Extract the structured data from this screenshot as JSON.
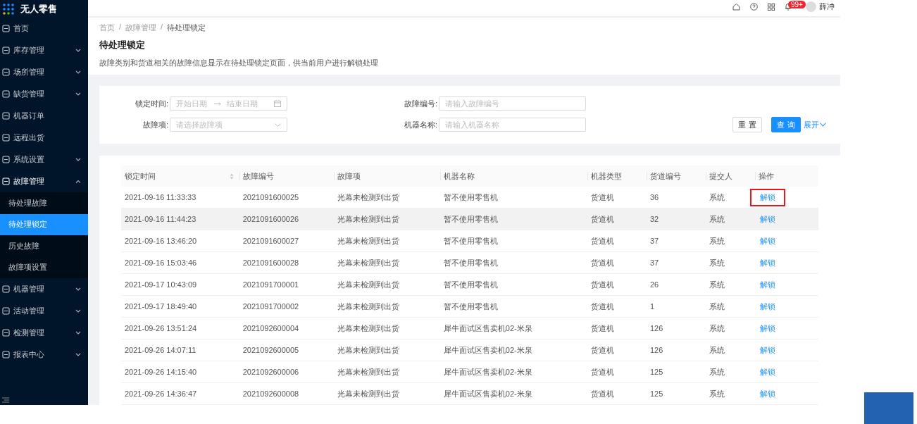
{
  "app": {
    "title": "无人零售"
  },
  "sidebar": {
    "items": [
      {
        "label": "首页",
        "kind": "link",
        "expanded": false
      },
      {
        "label": "库存管理",
        "kind": "group",
        "expanded": false
      },
      {
        "label": "场所管理",
        "kind": "group",
        "expanded": false
      },
      {
        "label": "缺货管理",
        "kind": "group",
        "expanded": false
      },
      {
        "label": "机器订单",
        "kind": "link",
        "expanded": false
      },
      {
        "label": "远程出货",
        "kind": "link",
        "expanded": false
      },
      {
        "label": "系统设置",
        "kind": "group",
        "expanded": false
      },
      {
        "label": "故障管理",
        "kind": "group",
        "expanded": true,
        "children": [
          {
            "label": "待处理故障",
            "selected": false
          },
          {
            "label": "待处理锁定",
            "selected": true
          },
          {
            "label": "历史故障",
            "selected": false
          },
          {
            "label": "故障项设置",
            "selected": false
          }
        ]
      },
      {
        "label": "机器管理",
        "kind": "group",
        "expanded": false
      },
      {
        "label": "活动管理",
        "kind": "group",
        "expanded": false
      },
      {
        "label": "检测管理",
        "kind": "group",
        "expanded": false
      },
      {
        "label": "报表中心",
        "kind": "group",
        "expanded": false
      }
    ]
  },
  "header": {
    "badge": "99+",
    "user": "薛冲"
  },
  "breadcrumb": [
    {
      "kind": "link",
      "text": "首页"
    },
    {
      "kind": "separator",
      "text": "/"
    },
    {
      "kind": "link",
      "text": "故障管理"
    },
    {
      "kind": "separator",
      "text": "/"
    },
    {
      "kind": "current",
      "text": "待处理锁定"
    }
  ],
  "page": {
    "title": "待处理锁定",
    "description": "故障类别和货道相关的故障信息显示在待处理锁定页面，供当前用户进行解锁处理"
  },
  "filters": {
    "lock_time": {
      "label": "锁定时间:",
      "start_placeholder": "开始日期",
      "end_placeholder": "结束日期"
    },
    "fault_no": {
      "label": "故障编号:",
      "placeholder": "请输入故障编号"
    },
    "fault_item": {
      "label": "故障项:",
      "placeholder": "请选择故障项"
    },
    "machine_name": {
      "label": "机器名称:",
      "placeholder": "请输入机器名称"
    },
    "reset": "重 置",
    "search": "查 询",
    "expand": "展开"
  },
  "table": {
    "columns": [
      "锁定时间",
      "故障编号",
      "故障项",
      "机器名称",
      "机器类型",
      "货道编号",
      "提交人",
      "操作"
    ],
    "rows": [
      {
        "cells": [
          "2021-09-16 11:33:33",
          "2021091600025",
          "光幕未检测到出货",
          "暂不使用零售机",
          "货道机",
          "36",
          "系统"
        ],
        "action": "解锁",
        "hovered": false,
        "highlighted": true
      },
      {
        "cells": [
          "2021-09-16 11:44:23",
          "2021091600026",
          "光幕未检测到出货",
          "暂不使用零售机",
          "货道机",
          "32",
          "系统"
        ],
        "action": "解锁",
        "hovered": true,
        "highlighted": false
      },
      {
        "cells": [
          "2021-09-16 13:46:20",
          "2021091600027",
          "光幕未检测到出货",
          "暂不使用零售机",
          "货道机",
          "37",
          "系统"
        ],
        "action": "解锁",
        "hovered": false,
        "highlighted": false
      },
      {
        "cells": [
          "2021-09-16 15:03:46",
          "2021091600028",
          "光幕未检测到出货",
          "暂不使用零售机",
          "货道机",
          "37",
          "系统"
        ],
        "action": "解锁",
        "hovered": false,
        "highlighted": false
      },
      {
        "cells": [
          "2021-09-17 10:43:09",
          "2021091700001",
          "光幕未检测到出货",
          "暂不使用零售机",
          "货道机",
          "26",
          "系统"
        ],
        "action": "解锁",
        "hovered": false,
        "highlighted": false
      },
      {
        "cells": [
          "2021-09-17 18:49:40",
          "2021091700002",
          "光幕未检测到出货",
          "暂不使用零售机",
          "货道机",
          "1",
          "系统"
        ],
        "action": "解锁",
        "hovered": false,
        "highlighted": false
      },
      {
        "cells": [
          "2021-09-26 13:51:24",
          "2021092600004",
          "光幕未检测到出货",
          "犀牛面试区售卖机02-米泉",
          "货道机",
          "126",
          "系统"
        ],
        "action": "解锁",
        "hovered": false,
        "highlighted": false
      },
      {
        "cells": [
          "2021-09-26 14:07:11",
          "2021092600005",
          "光幕未检测到出货",
          "犀牛面试区售卖机02-米泉",
          "货道机",
          "126",
          "系统"
        ],
        "action": "解锁",
        "hovered": false,
        "highlighted": false
      },
      {
        "cells": [
          "2021-09-26 14:15:40",
          "2021092600006",
          "光幕未检测到出货",
          "犀牛面试区售卖机02-米泉",
          "货道机",
          "125",
          "系统"
        ],
        "action": "解锁",
        "hovered": false,
        "highlighted": false
      },
      {
        "cells": [
          "2021-09-26 14:36:47",
          "2021092600008",
          "光幕未检测到出货",
          "犀牛面试区售卖机02-米泉",
          "货道机",
          "125",
          "系统"
        ],
        "action": "解锁",
        "hovered": false,
        "highlighted": false
      }
    ]
  }
}
